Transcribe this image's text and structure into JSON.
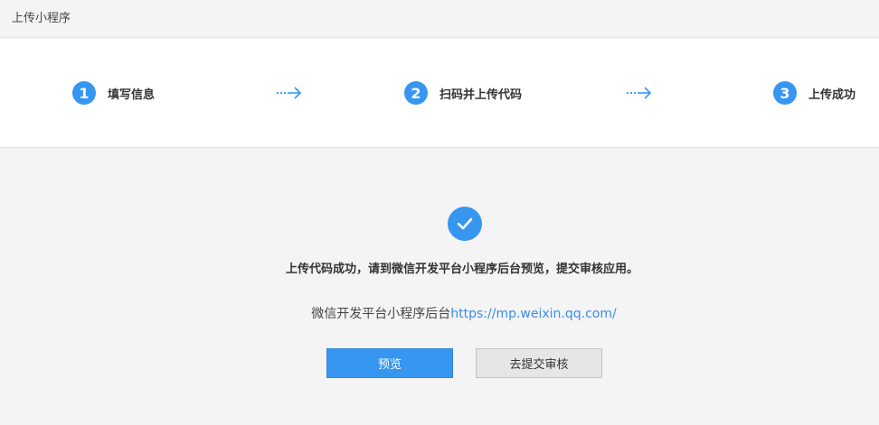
{
  "header": {
    "title": "上传小程序"
  },
  "steps": [
    {
      "number": "1",
      "label": "填写信息"
    },
    {
      "number": "2",
      "label": "扫码并上传代码"
    },
    {
      "number": "3",
      "label": "上传成功"
    }
  ],
  "result": {
    "message": "上传代码成功，请到微信开发平台小程序后台预览，提交审核应用。",
    "link_prefix": "微信开发平台小程序后台",
    "link_text": "https://mp.weixin.qq.com/"
  },
  "buttons": {
    "preview_label": "预览",
    "submit_label": "去提交审核"
  },
  "colors": {
    "accent": "#3796f0",
    "link": "#3a8ee6"
  }
}
